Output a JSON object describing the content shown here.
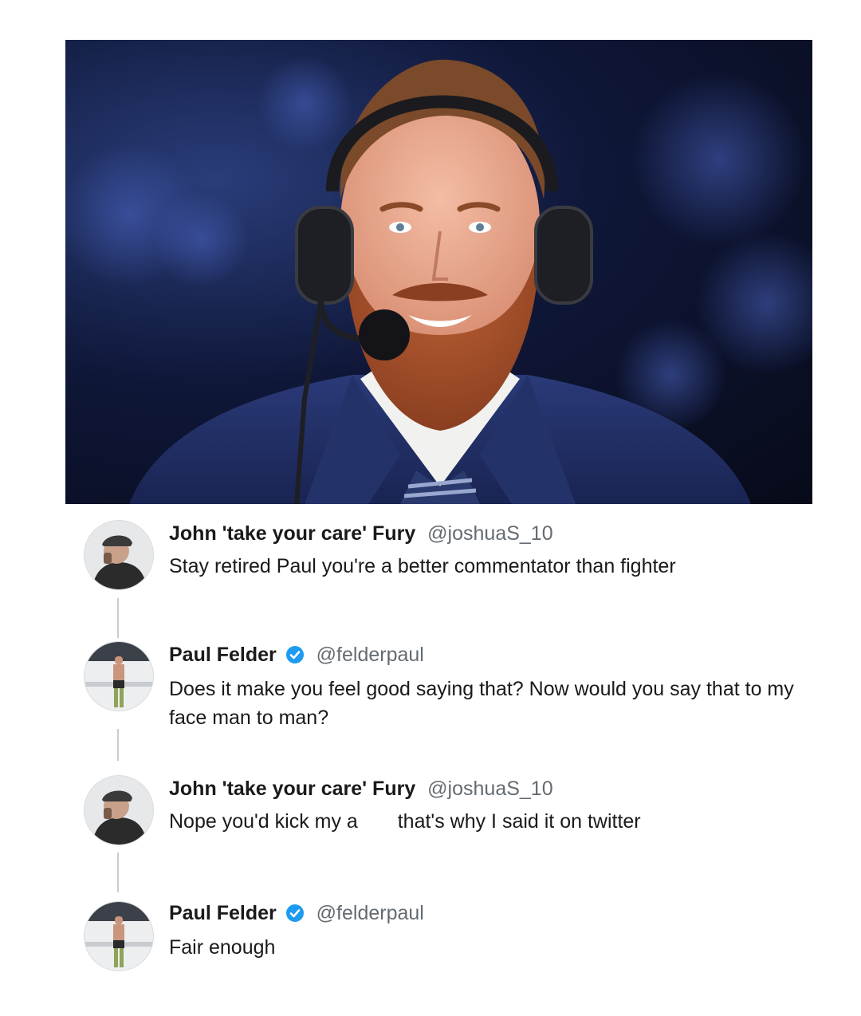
{
  "hero_image": {
    "icon": "commentator-headset-photo",
    "colors": {
      "background": "#0f1738",
      "suit": "#1f2d63",
      "shirt": "#f1f1ef",
      "beard": "#a8502a",
      "hair": "#7a4a2a",
      "skin": "#e9a98f"
    }
  },
  "thread": {
    "tweets": [
      {
        "name": "John 'take your care' Fury",
        "handle": "@joshuaS_10",
        "verified": false,
        "text": "Stay retired Paul you're a better commentator than fighter"
      },
      {
        "name": "Paul Felder",
        "handle": "@felderpaul",
        "verified": true,
        "text": "Does it make you feel good saying that? Now would you say that to my face man to man?"
      },
      {
        "name": "John 'take your care' Fury",
        "handle": "@joshuaS_10",
        "verified": false,
        "text_part1": "Nope you'd kick my a",
        "text_part2": "that's why I said it on twitter"
      },
      {
        "name": "Paul Felder",
        "handle": "@felderpaul",
        "verified": true,
        "text": "Fair enough"
      }
    ],
    "colors": {
      "name": "#1a1a1a",
      "handle": "#646b72",
      "verified_badge": "#1d9bf0",
      "connector": "#c9cdd1"
    }
  }
}
